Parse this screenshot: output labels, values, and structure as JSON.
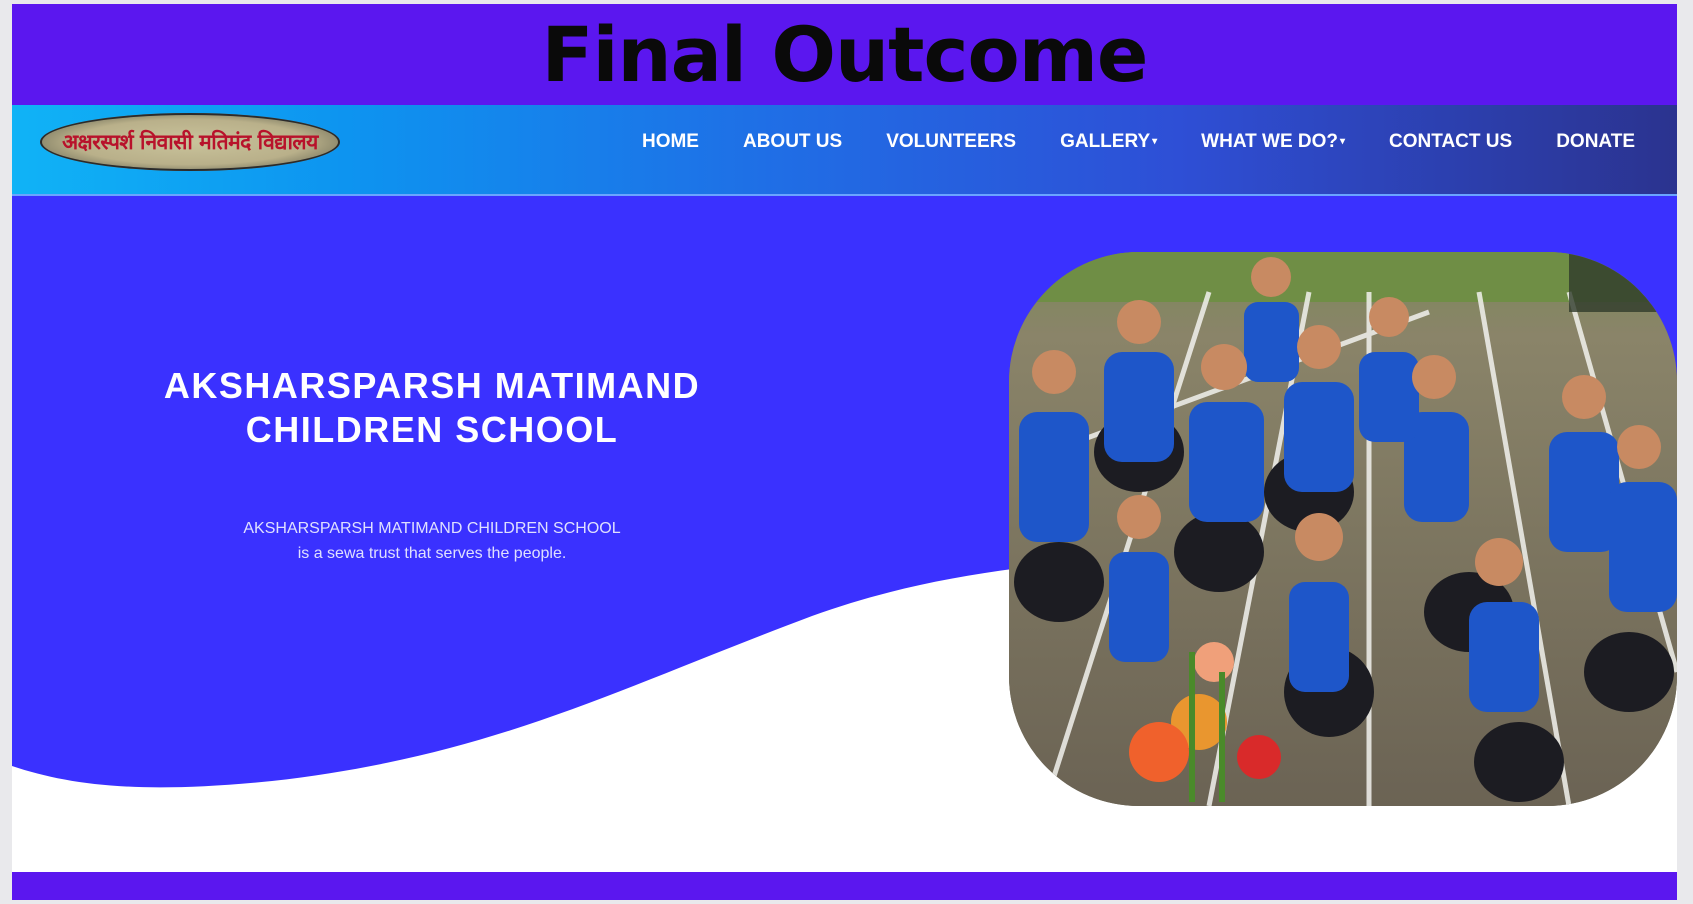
{
  "banner": {
    "title": "Final Outcome"
  },
  "header": {
    "logo_text": "अक्षरस्पर्श निवासी मतिमंद विद्यालय",
    "nav": [
      {
        "label": "HOME",
        "has_dropdown": false
      },
      {
        "label": "ABOUT US",
        "has_dropdown": false
      },
      {
        "label": "VOLUNTEERS",
        "has_dropdown": false
      },
      {
        "label": "GALLERY",
        "has_dropdown": true
      },
      {
        "label": "WHAT WE DO?",
        "has_dropdown": true
      },
      {
        "label": "CONTACT US",
        "has_dropdown": false
      },
      {
        "label": "DONATE",
        "has_dropdown": false
      }
    ],
    "caret_glyph": "▾"
  },
  "hero": {
    "title_line1": "AKSHARSPARSH MATIMAND",
    "title_line2": "CHILDREN SCHOOL",
    "subtitle_line1": "AKSHARSPARSH MATIMAND CHILDREN SCHOOL",
    "subtitle_line2": "is a sewa trust that serves the people.",
    "image_subject": "children in blue shirts sitting on ground"
  },
  "colors": {
    "banner": "#5b17ef",
    "hero_blue": "#3a31ff",
    "nav_gradient_start": "#10b3f6",
    "nav_gradient_end": "#2b338f"
  }
}
